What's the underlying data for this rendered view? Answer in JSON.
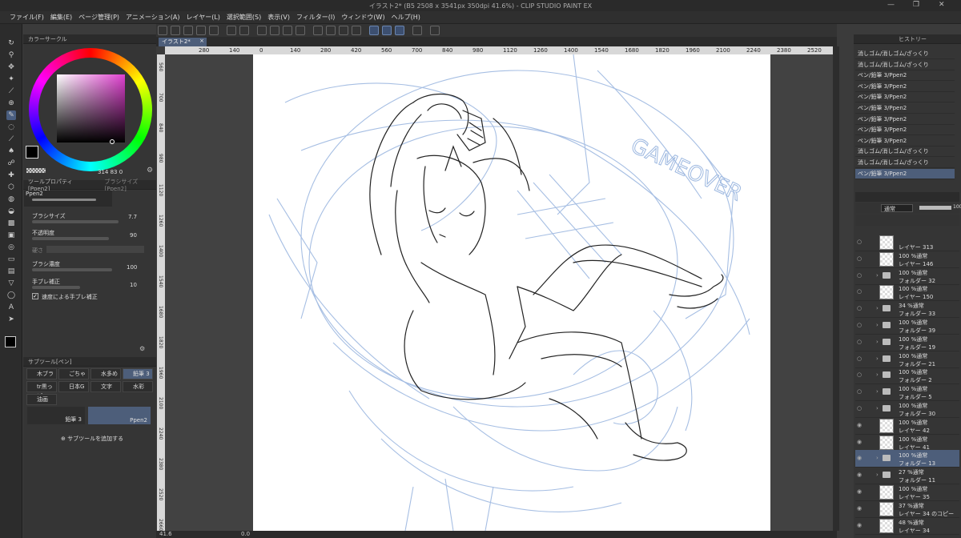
{
  "app": {
    "title": "イラスト2* (B5 2508 x 3541px 350dpi 41.6%) - CLIP STUDIO PAINT EX"
  },
  "menu": [
    "ファイル(F)",
    "編集(E)",
    "ページ管理(P)",
    "アニメーション(A)",
    "レイヤー(L)",
    "選択範囲(S)",
    "表示(V)",
    "フィルター(I)",
    "ウィンドウ(W)",
    "ヘルプ(H)"
  ],
  "document_tab": "イラスト2*",
  "ruler_h": [
    "280",
    "140",
    "0",
    "140",
    "280",
    "420",
    "560",
    "700",
    "840",
    "980",
    "1120",
    "1260",
    "1400",
    "1540",
    "1680",
    "1820",
    "1960",
    "2100",
    "2240",
    "2380",
    "2520",
    "2660"
  ],
  "ruler_v": [
    "560",
    "700",
    "840",
    "980",
    "1120",
    "1260",
    "1400",
    "1540",
    "1680",
    "1820",
    "1960",
    "2100",
    "2240",
    "2380",
    "2520",
    "2660"
  ],
  "color_panel": {
    "tab": "カラーサークル",
    "readout": "314  83  0"
  },
  "tool_property": {
    "tab": "ツールプロパティ[Ppen2]",
    "tab2": "ブラシサイズ[Ppen2]",
    "brush_name": "Ppen2",
    "brush_size_label": "ブラシサイズ",
    "brush_size_value": "7.7",
    "opacity_label": "不透明度",
    "opacity_value": "90",
    "hardness_label": "硬さ",
    "density_label": "ブラシ濃度",
    "density_value": "100",
    "stabilization_label": "手ブレ補正",
    "stabilization_value": "10",
    "speed_stab_label": "速度による手ブレ補正"
  },
  "subtool": {
    "tab": "サブツール[ペン]",
    "items": [
      "木ブラシ",
      "ごちゃ",
      "水多め",
      "鉛筆 3",
      "tr黒っぽ",
      "日本G",
      "文字",
      "水彩",
      "油画"
    ],
    "preview_left": "鉛筆 3",
    "preview_right": "Ppen2",
    "add_label": "サブツールを追加する"
  },
  "history": {
    "tab": "ヒストリー",
    "items": [
      "消しゴム/消しゴム/ざっくり",
      "消しゴム/消しゴム/ざっくり",
      "ペン/鉛筆 3/Ppen2",
      "ペン/鉛筆 3/Ppen2",
      "ペン/鉛筆 3/Ppen2",
      "ペン/鉛筆 3/Ppen2",
      "ペン/鉛筆 3/Ppen2",
      "ペン/鉛筆 3/Ppen2",
      "ペン/鉛筆 3/Ppen2",
      "消しゴム/消しゴム/ざっくり",
      "消しゴム/消しゴム/ざっくり",
      "ペン/鉛筆 3/Ppen2"
    ]
  },
  "layer_panel": {
    "blend_mode": "通常",
    "opacity": "100",
    "layers": [
      {
        "top": "",
        "bottom": "レイヤー 313",
        "type": "layer"
      },
      {
        "top": "100 %通常",
        "bottom": "レイヤー 146",
        "type": "layer"
      },
      {
        "top": "100 %通常",
        "bottom": "フォルダー 32",
        "type": "folder"
      },
      {
        "top": "100 %通常",
        "bottom": "レイヤー 150",
        "type": "layer"
      },
      {
        "top": "34 %通常",
        "bottom": "フォルダー 33",
        "type": "folder"
      },
      {
        "top": "100 %通常",
        "bottom": "フォルダー 39",
        "type": "folder"
      },
      {
        "top": "100 %通常",
        "bottom": "フォルダー 19",
        "type": "folder"
      },
      {
        "top": "100 %通常",
        "bottom": "フォルダー 21",
        "type": "folder"
      },
      {
        "top": "100 %通常",
        "bottom": "フォルダー 2",
        "type": "folder"
      },
      {
        "top": "100 %通常",
        "bottom": "フォルダー 5",
        "type": "folder"
      },
      {
        "top": "100 %通常",
        "bottom": "フォルダー 30",
        "type": "folder"
      },
      {
        "top": "100 %通常",
        "bottom": "レイヤー 42",
        "type": "layer"
      },
      {
        "top": "100 %通常",
        "bottom": "レイヤー 41",
        "type": "layer"
      },
      {
        "top": "100 %通常",
        "bottom": "フォルダー 13",
        "type": "folder-sel"
      },
      {
        "top": "27 %通常",
        "bottom": "フォルダー 11",
        "type": "folder"
      },
      {
        "top": "100 %通常",
        "bottom": "レイヤー 35",
        "type": "layer"
      },
      {
        "top": "37 %通常",
        "bottom": "レイヤー 34 のコピー",
        "type": "layer"
      },
      {
        "top": "48 %通常",
        "bottom": "レイヤー 34",
        "type": "layer"
      }
    ]
  },
  "status": {
    "zoom": "41.6",
    "angle": "0.0"
  },
  "canvas_text": "GAMEOVER",
  "colors": {
    "accent": "#4d5e7a",
    "panel": "#353535",
    "sketch_blue": "#9db8e0"
  },
  "icons": [
    "brush-icon",
    "eyedropper-icon",
    "move-icon",
    "lasso-icon",
    "eraser-icon",
    "fill-icon",
    "gradient-icon",
    "text-icon",
    "figure-icon",
    "zoom-icon",
    "undo-icon",
    "redo-icon",
    "eye-icon",
    "folder-icon",
    "lock-icon",
    "gear-icon",
    "trash-icon",
    "plus-icon"
  ]
}
